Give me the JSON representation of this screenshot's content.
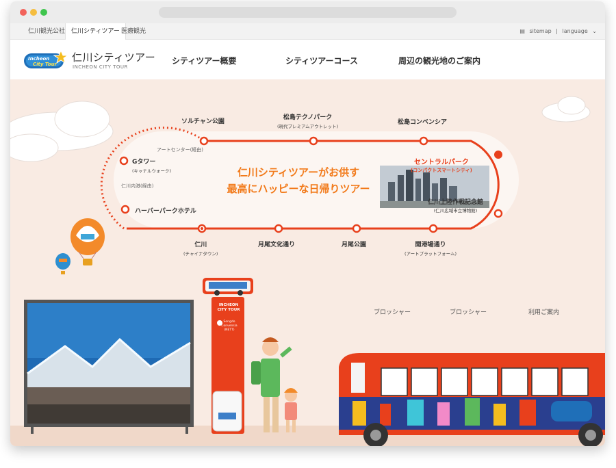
{
  "browser": {
    "top_tabs": [
      "仁川観光公社",
      "仁川シティツアー",
      "医療観光"
    ],
    "sitemap": "sitemap",
    "language": "language"
  },
  "header": {
    "logo_text": "Incheon City Tour",
    "title": "仁川シティツアー",
    "subtitle": "INCHEON CITY TOUR",
    "nav": [
      "シティツアー概要",
      "シティツアーコース",
      "周辺の観光地のご案内"
    ]
  },
  "hero": {
    "headline_1": "仁川シティツアーがお供す",
    "headline_2": "最高にハッピーな日帰りツアー",
    "stops": {
      "solchan": "ソルチャン公園",
      "songdo_techno": "松島テクノパーク",
      "songdo_techno_sub": "(現代プレミアムアウトレット)",
      "convensia": "松島コンベンシア",
      "art_center": "アートセンター(経由)",
      "g_tower": "Gタワー",
      "g_tower_sub": "(キャナルウォーク)",
      "inner_port": "仁川内港(経由)",
      "harbor_park": "ハーバーパークホテル",
      "central_park": "セントラルパーク",
      "central_park_sub": "(コンパクトスマートシティ)",
      "museum": "仁川上陸作戦記念館",
      "museum_sub": "(仁川広域市立博物館)",
      "incheon": "仁川",
      "incheon_sub": "(チャイナタウン)",
      "wolmi_culture": "月尾文化通り",
      "wolmi_park": "月尾公園",
      "gaehang": "開港場通り",
      "gaehang_sub": "(アートプラットフォーム)"
    },
    "links": [
      "ブロッシャー",
      "ブロッシャー",
      "利用ご案内"
    ],
    "pole_title": "INCHEON CITY TOUR",
    "pole_stop": "Songdo Convensia (NETT)"
  },
  "colors": {
    "route": "#e8401c",
    "accent": "#f27a1a",
    "hero_bg": "#f9ebe3"
  }
}
